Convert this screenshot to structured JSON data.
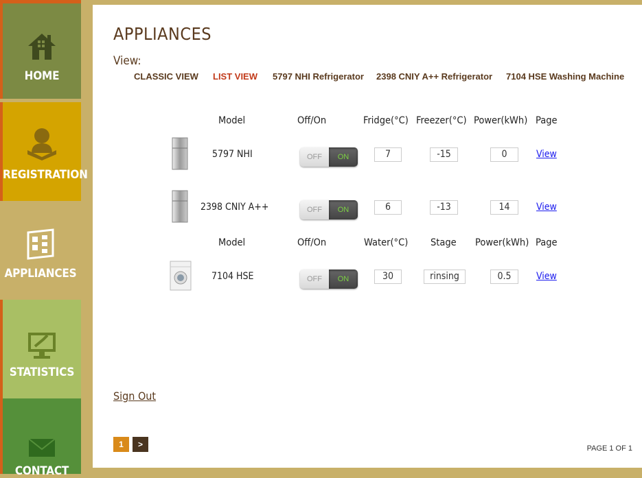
{
  "sidebar": {
    "items": [
      {
        "label": "HOME",
        "icon": "house-icon"
      },
      {
        "label": "REGISTRATION",
        "icon": "user-reading-icon"
      },
      {
        "label": "APPLIANCES",
        "icon": "appliance-panel-icon"
      },
      {
        "label": "STATISTICS",
        "icon": "monitor-chart-icon"
      },
      {
        "label": "CONTACT",
        "icon": "envelope-icon"
      }
    ]
  },
  "page": {
    "title": "APPLIANCES",
    "view_label": "View:",
    "view_nav": [
      "CLASSIC VIEW",
      "LIST VIEW",
      "5797 NHI Refrigerator",
      "2398 CNIY A++ Refrigerator",
      "7104 HSE Washing Machine"
    ],
    "active_view": "LIST VIEW"
  },
  "fridge_table": {
    "headers": [
      "Model",
      "Off/On",
      "Fridge(°C)",
      "Freezer(°C)",
      "Power(kWh)",
      "Page"
    ],
    "rows": [
      {
        "model": "5797 NHI",
        "off": "OFF",
        "on": "ON",
        "fridge": "7",
        "freezer": "-15",
        "power": "0",
        "link": "View"
      },
      {
        "model": "2398 CNIY A++",
        "off": "OFF",
        "on": "ON",
        "fridge": "6",
        "freezer": "-13",
        "power": "14",
        "link": "View"
      }
    ]
  },
  "washer_table": {
    "headers": [
      "Model",
      "Off/On",
      "Water(°C)",
      "Stage",
      "Power(kWh)",
      "Page"
    ],
    "rows": [
      {
        "model": "7104 HSE",
        "off": "OFF",
        "on": "ON",
        "water": "30",
        "stage": "rinsing",
        "power": "0.5",
        "link": "View"
      }
    ]
  },
  "footer": {
    "sign_out": "Sign Out",
    "pages": [
      "1",
      ">"
    ],
    "page_info": "PAGE 1 OF 1"
  },
  "colors": {
    "home": "#7c8a44",
    "registration": "#d4a400",
    "appliances": "#c8b069",
    "statistics": "#a9bf64",
    "contact": "#55903a",
    "accent": "#d4601a",
    "title": "#5a3a1e",
    "active": "#c23a1a"
  }
}
